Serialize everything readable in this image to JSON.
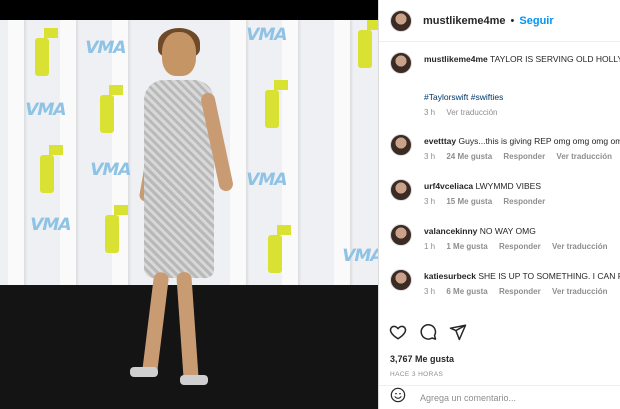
{
  "post": {
    "username": "mustlikeme4me",
    "follow_label": "Seguir",
    "dot": "•"
  },
  "caption": {
    "username": "mustlikeme4me",
    "text": "TAYLOR IS SERVING OLD HOLLYWOOD VMAS!!",
    "tags": "#Taylorswift #swifties",
    "time": "3 h",
    "translate": "Ver traducción"
  },
  "comments": [
    {
      "username": "evetttay",
      "text": "Guys...this is giving REP omg omg omg omg",
      "time": "3 h",
      "likes": "24 Me gusta",
      "reply": "Responder",
      "translate": "Ver traducción"
    },
    {
      "username": "urf4vceliaca",
      "text": "LWYMMD VIBES",
      "time": "3 h",
      "likes": "15 Me gusta",
      "reply": "Responder",
      "translate": ""
    },
    {
      "username": "valancekinny",
      "text": "NO WAY OMG",
      "time": "1 h",
      "likes": "1 Me gusta",
      "reply": "Responder",
      "translate": "Ver traducción"
    },
    {
      "username": "katiesurbeck",
      "text": "SHE IS UP TO SOMETHING. I CAN FEEL IT",
      "time": "3 h",
      "likes": "6 Me gusta",
      "reply": "Responder",
      "translate": "Ver traducción"
    }
  ],
  "stats": {
    "likes": "3,767 Me gusta",
    "time": "HACE 3 HORAS"
  },
  "add_comment": {
    "placeholder": "Agrega un comentario..."
  },
  "media": {
    "logo_text": "VMA"
  },
  "colors": {
    "link": "#0095f6",
    "hashtag": "#00376b",
    "muted": "#8e8e8e",
    "text": "#262626"
  }
}
